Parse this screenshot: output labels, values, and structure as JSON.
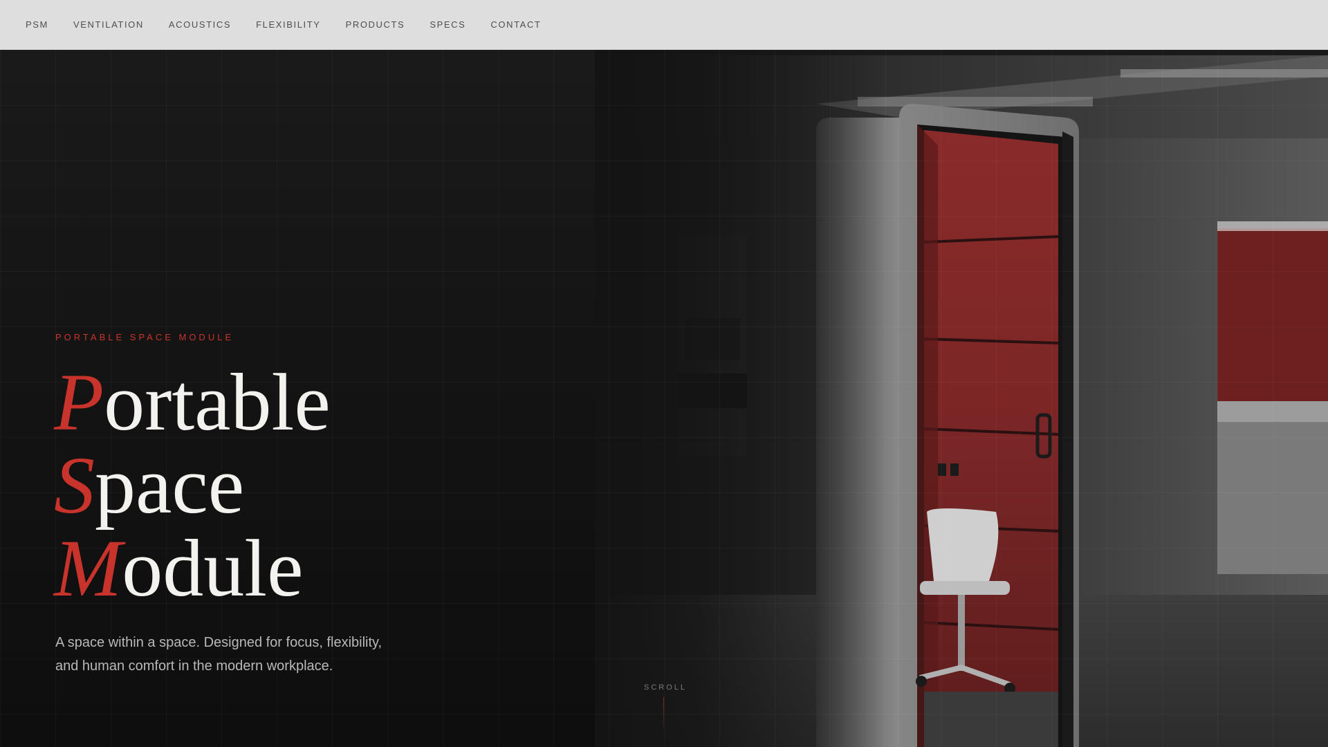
{
  "nav": {
    "items": [
      {
        "label": "PSM"
      },
      {
        "label": "VENTILATION"
      },
      {
        "label": "ACOUSTICS"
      },
      {
        "label": "FLEXIBILITY"
      },
      {
        "label": "PRODUCTS"
      },
      {
        "label": "SPECS"
      },
      {
        "label": "CONTACT"
      }
    ]
  },
  "hero": {
    "eyebrow": "PORTABLE SPACE MODULE",
    "headline": [
      {
        "initial": "P",
        "rest": "ortable"
      },
      {
        "initial": "S",
        "rest": "pace"
      },
      {
        "initial": "M",
        "rest": "odule"
      }
    ],
    "tagline_line1": "A space within a space. Designed for focus, flexibility,",
    "tagline_line2": "and human comfort in the modern workplace.",
    "scroll_label": "SCROLL"
  },
  "colors": {
    "accent": "#c8342c",
    "nav_background": "#dedede",
    "hero_background": "#141414",
    "headline_text": "#f4f2ee"
  }
}
